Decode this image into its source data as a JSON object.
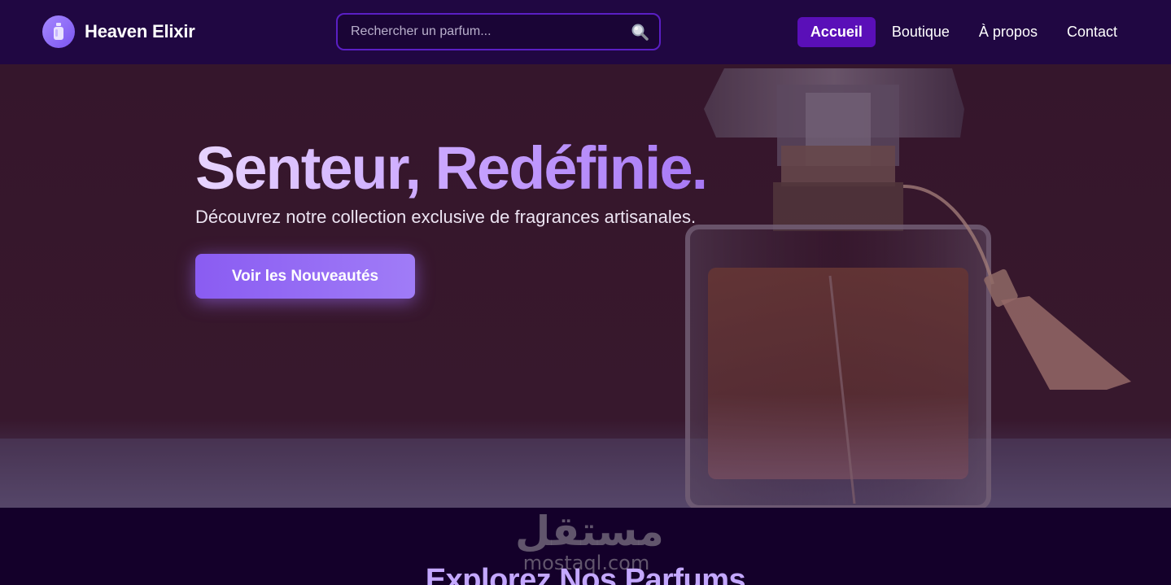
{
  "header": {
    "brand_name": "Heaven Elixir",
    "search_placeholder": "Rechercher un parfum...",
    "nav": [
      {
        "label": "Accueil",
        "active": true
      },
      {
        "label": "Boutique",
        "active": false
      },
      {
        "label": "À propos",
        "active": false
      },
      {
        "label": "Contact",
        "active": false
      }
    ]
  },
  "hero": {
    "title": "Senteur, Redéfinie.",
    "subtitle": "Découvrez notre collection exclusive de fragrances artisanales.",
    "cta_label": "Voir les Nouveautés"
  },
  "section": {
    "title": "Explorez Nos Parfums"
  },
  "watermark": {
    "arabic": "مستقل",
    "latin": "mostaql.com"
  },
  "colors": {
    "header_bg": "#200742",
    "accent": "#5a0fb8",
    "cta": "#8a5cf2",
    "page_bg": "#14002a"
  }
}
